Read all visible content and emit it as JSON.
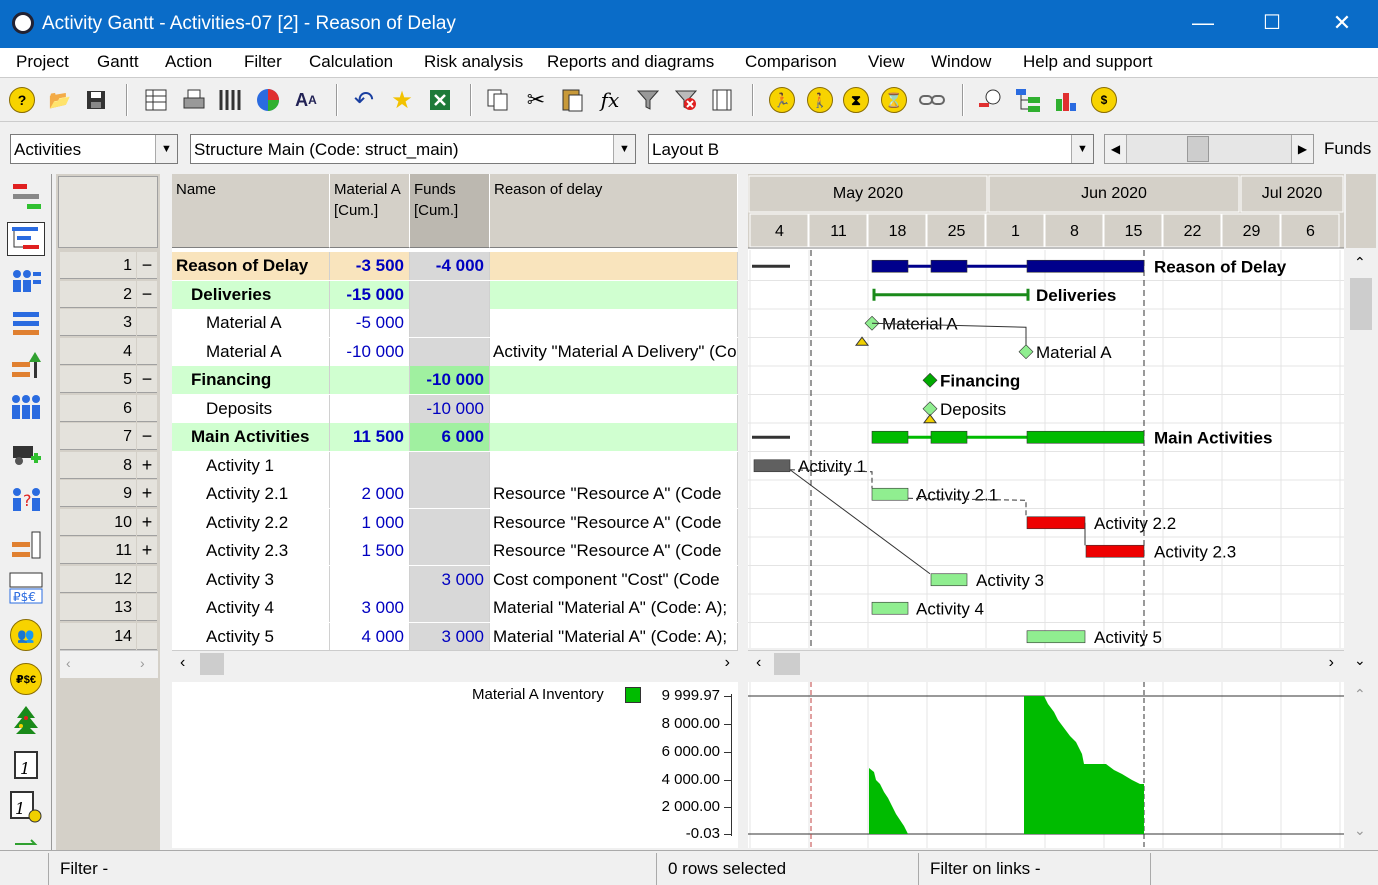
{
  "window": {
    "title": "Activity Gantt - Activities-07 [2] - Reason of Delay",
    "minimize": "—",
    "maximize": "☐",
    "close": "✕"
  },
  "menu": [
    "Project",
    "Gantt",
    "Action",
    "Filter",
    "Calculation",
    "Risk analysis",
    "Reports and diagrams",
    "Comparison",
    "View",
    "Window",
    "Help and support"
  ],
  "selectors": {
    "object": "Activities",
    "structure": "Structure Main (Code: struct_main)",
    "layout": "Layout B",
    "funds_label": "Funds"
  },
  "table": {
    "columns": [
      {
        "key": "name",
        "label": "Name"
      },
      {
        "key": "material",
        "label": "Material A\n[Cum.]"
      },
      {
        "key": "funds",
        "label": "Funds\n[Cum.]"
      },
      {
        "key": "reason",
        "label": "Reason of delay"
      }
    ],
    "rows": [
      {
        "n": "1",
        "sign": "−",
        "name": "Reason of Delay",
        "material": "-3 500",
        "funds": "-4 000",
        "reason": "",
        "level": 0
      },
      {
        "n": "2",
        "sign": "−",
        "name": "Deliveries",
        "material": "-15 000",
        "funds": "",
        "reason": "",
        "level": 1
      },
      {
        "n": "3",
        "sign": "",
        "name": "Material A",
        "material": "-5 000",
        "funds": "",
        "reason": "",
        "level": 2
      },
      {
        "n": "4",
        "sign": "",
        "name": "Material A",
        "material": "-10 000",
        "funds": "",
        "reason": "Activity \"Material A Delivery\" (Co",
        "level": 2
      },
      {
        "n": "5",
        "sign": "−",
        "name": "Financing",
        "material": "",
        "funds": "-10 000",
        "reason": "",
        "level": 1
      },
      {
        "n": "6",
        "sign": "",
        "name": "Deposits",
        "material": "",
        "funds": "-10 000",
        "reason": "",
        "level": 2
      },
      {
        "n": "7",
        "sign": "−",
        "name": "Main Activities",
        "material": "11 500",
        "funds": "6 000",
        "reason": "",
        "level": 1
      },
      {
        "n": "8",
        "sign": "+",
        "name": "Activity 1",
        "material": "",
        "funds": "",
        "reason": "",
        "level": 2
      },
      {
        "n": "9",
        "sign": "+",
        "name": "Activity 2.1",
        "material": "2 000",
        "funds": "",
        "reason": "Resource \"Resource A\" (Code",
        "level": 2
      },
      {
        "n": "10",
        "sign": "+",
        "name": "Activity 2.2",
        "material": "1 000",
        "funds": "",
        "reason": "Resource \"Resource A\" (Code",
        "level": 2
      },
      {
        "n": "11",
        "sign": "+",
        "name": "Activity 2.3",
        "material": "1 500",
        "funds": "",
        "reason": "Resource \"Resource A\" (Code",
        "level": 2
      },
      {
        "n": "12",
        "sign": "",
        "name": "Activity 3",
        "material": "",
        "funds": "3 000",
        "reason": "Cost component \"Cost\" (Code",
        "level": 2
      },
      {
        "n": "13",
        "sign": "",
        "name": "Activity 4",
        "material": "3 000",
        "funds": "",
        "reason": "Material \"Material A\" (Code: A);",
        "level": 2
      },
      {
        "n": "14",
        "sign": "",
        "name": "Activity 5",
        "material": "4 000",
        "funds": "3 000",
        "reason": "Material \"Material A\" (Code: A);",
        "level": 2
      }
    ]
  },
  "gantt": {
    "months": [
      "May 2020",
      "Jun 2020",
      "Jul 2020"
    ],
    "weeks": [
      "4",
      "11",
      "18",
      "25",
      "1",
      "8",
      "15",
      "22",
      "29",
      "6"
    ],
    "labels": [
      "Reason of Delay",
      "Deliveries",
      "Material A",
      "Material A",
      "Financing",
      "Deposits",
      "Main Activities",
      "Activity 1",
      "Activity 2.1",
      "Activity 2.2",
      "Activity 2.3",
      "Activity 3",
      "Activity 4",
      "Activity 5"
    ],
    "colors": {
      "summary": "#00008b",
      "deliveries": "#1a8a1a",
      "green": "#00bb00",
      "light": "#90ee90",
      "red": "#ee0000",
      "grey": "#606060"
    }
  },
  "inventory": {
    "legend": "Material A Inventory",
    "ticks": [
      "9 999.97",
      "8 000.00",
      "6 000.00",
      "4 000.00",
      "2 000.00",
      "-0.03"
    ],
    "color": "#00bb00"
  },
  "status": {
    "filter": "Filter -",
    "rows": "0 rows selected",
    "links": "Filter on links -"
  }
}
